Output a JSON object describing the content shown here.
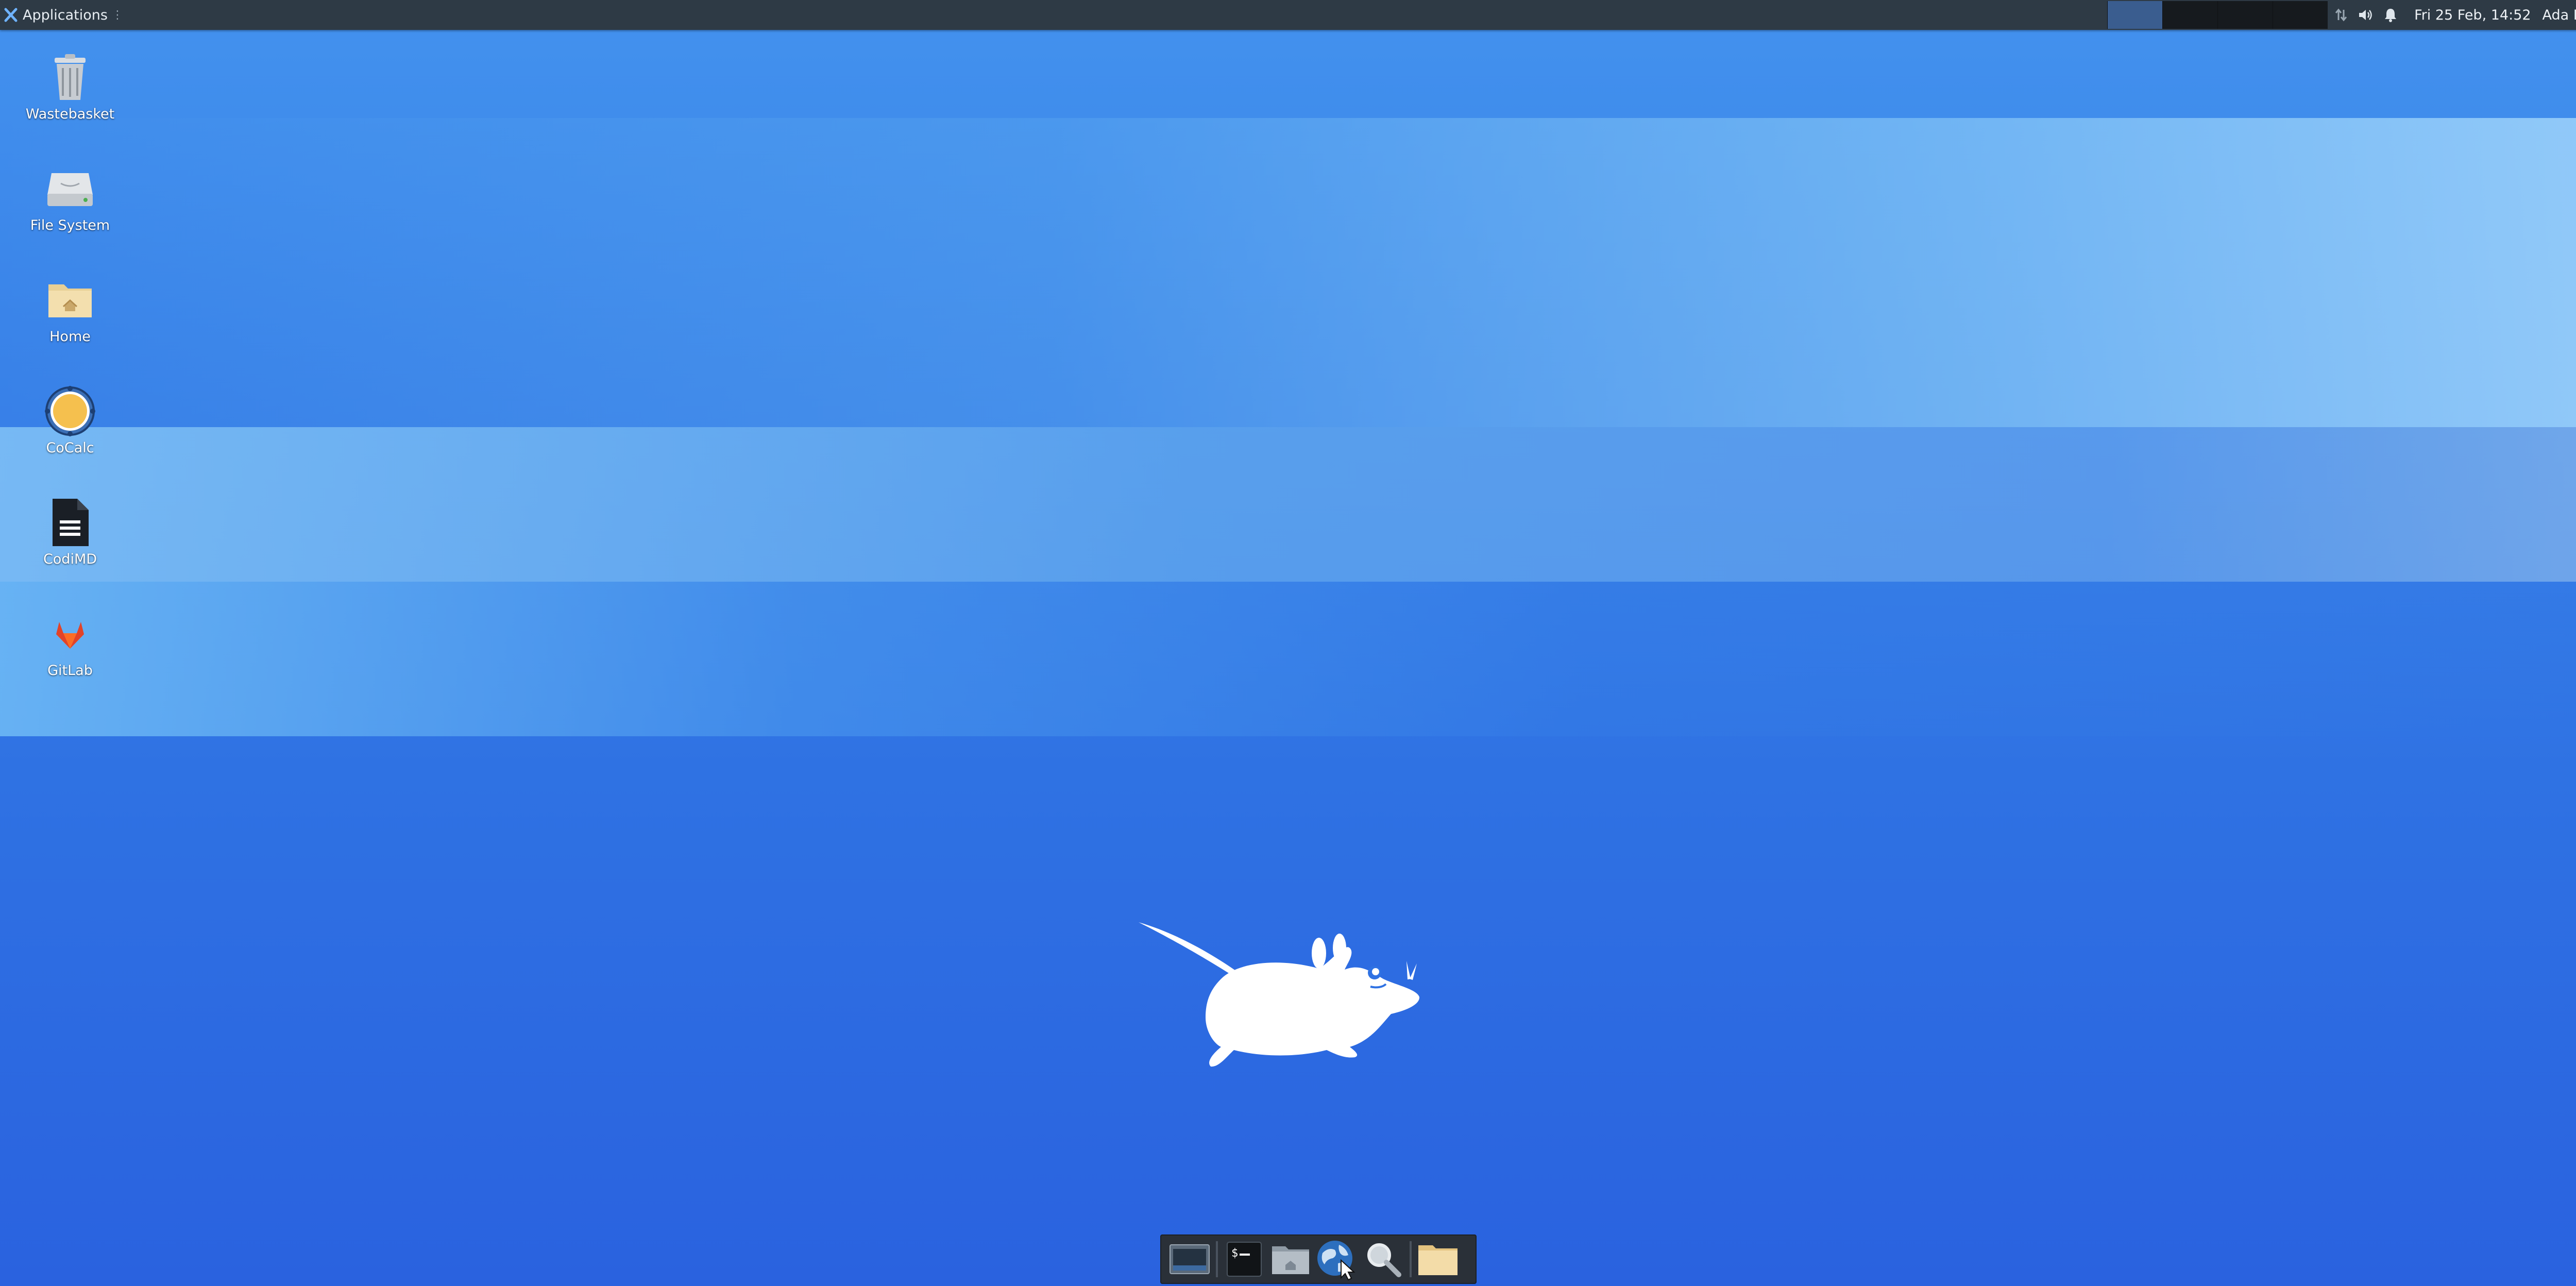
{
  "panel": {
    "applications_label": "Applications",
    "menu_handle": "⋮",
    "clock": "Fri 25 Feb, 14:52",
    "user": "Ada Lovelace",
    "workspaces_count": 4,
    "active_workspace": 1
  },
  "desktop_icons": [
    {
      "label": "Wastebasket",
      "icon": "trash-icon"
    },
    {
      "label": "File System",
      "icon": "drive-icon"
    },
    {
      "label": "Home",
      "icon": "home-folder-icon"
    },
    {
      "label": "CoCalc",
      "icon": "cocalc-icon"
    },
    {
      "label": "CodiMD",
      "icon": "codimd-icon"
    },
    {
      "label": "GitLab",
      "icon": "gitlab-icon"
    }
  ],
  "dock_items": [
    {
      "name": "show-desktop",
      "icon": "show-desktop-icon"
    },
    {
      "name": "terminal",
      "icon": "terminal-icon"
    },
    {
      "name": "home-folder",
      "icon": "home-folder-icon"
    },
    {
      "name": "web-browser",
      "icon": "globe-icon"
    },
    {
      "name": "app-finder",
      "icon": "magnifier-icon"
    },
    {
      "name": "file-manager",
      "icon": "folder-icon"
    }
  ],
  "colors": {
    "panel_bg": "#2e3a45",
    "desktop_top": "#4392ee",
    "desktop_bottom": "#2a62df",
    "active_workspace": "#3a5d8f"
  }
}
